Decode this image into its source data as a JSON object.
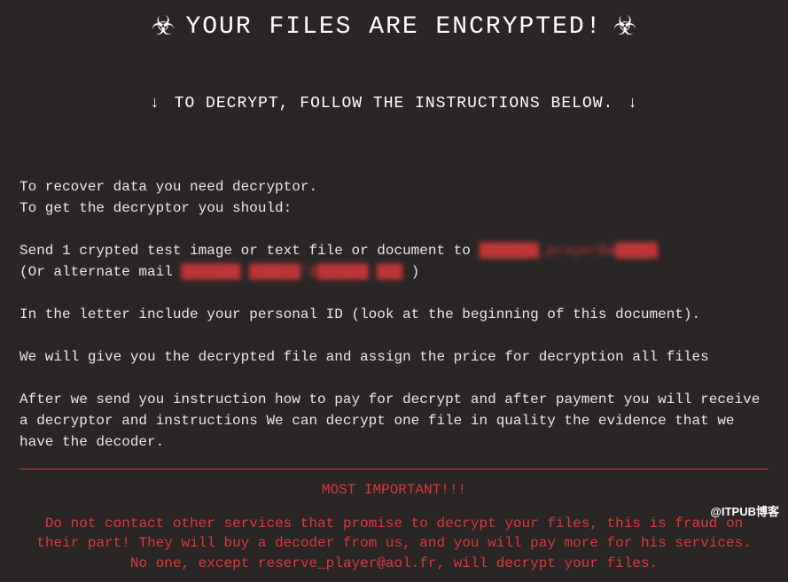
{
  "header": {
    "title": "YOUR FILES ARE ENCRYPTED!",
    "icon_name": "biohazard-icon"
  },
  "sub_header": {
    "text": "TO DECRYPT, FOLLOW THE INSTRUCTIONS BELOW."
  },
  "body": {
    "line1": "To recover data you need decryptor.",
    "line2": "To get the decryptor you should:",
    "line3_pre": "Send 1 crypted test image or text file or document to ",
    "line3_redacted": "███████_prayer@a█████",
    "line4_pre": "(Or alternate mail ",
    "line4_redacted": "███████ ██████'@██████ ███",
    "line4_post": " )",
    "line5": "In the letter include your personal ID (look at the beginning of this document).",
    "line6": "We will give you the decrypted file and assign the price for decryption all files",
    "line7": "After we send you instruction how to pay for decrypt and after payment you will receive a decryptor and instructions We can decrypt one file in quality the evidence that we have the decoder."
  },
  "important": {
    "header": "MOST IMPORTANT!!!",
    "warning": "Do not contact other services that promise to decrypt your files, this is fraud on their part! They will buy a decoder from us, and you will pay more for his services. No one, except reserve_player@aol.fr, will decrypt your files."
  },
  "watermark": "@ITPUB博客"
}
